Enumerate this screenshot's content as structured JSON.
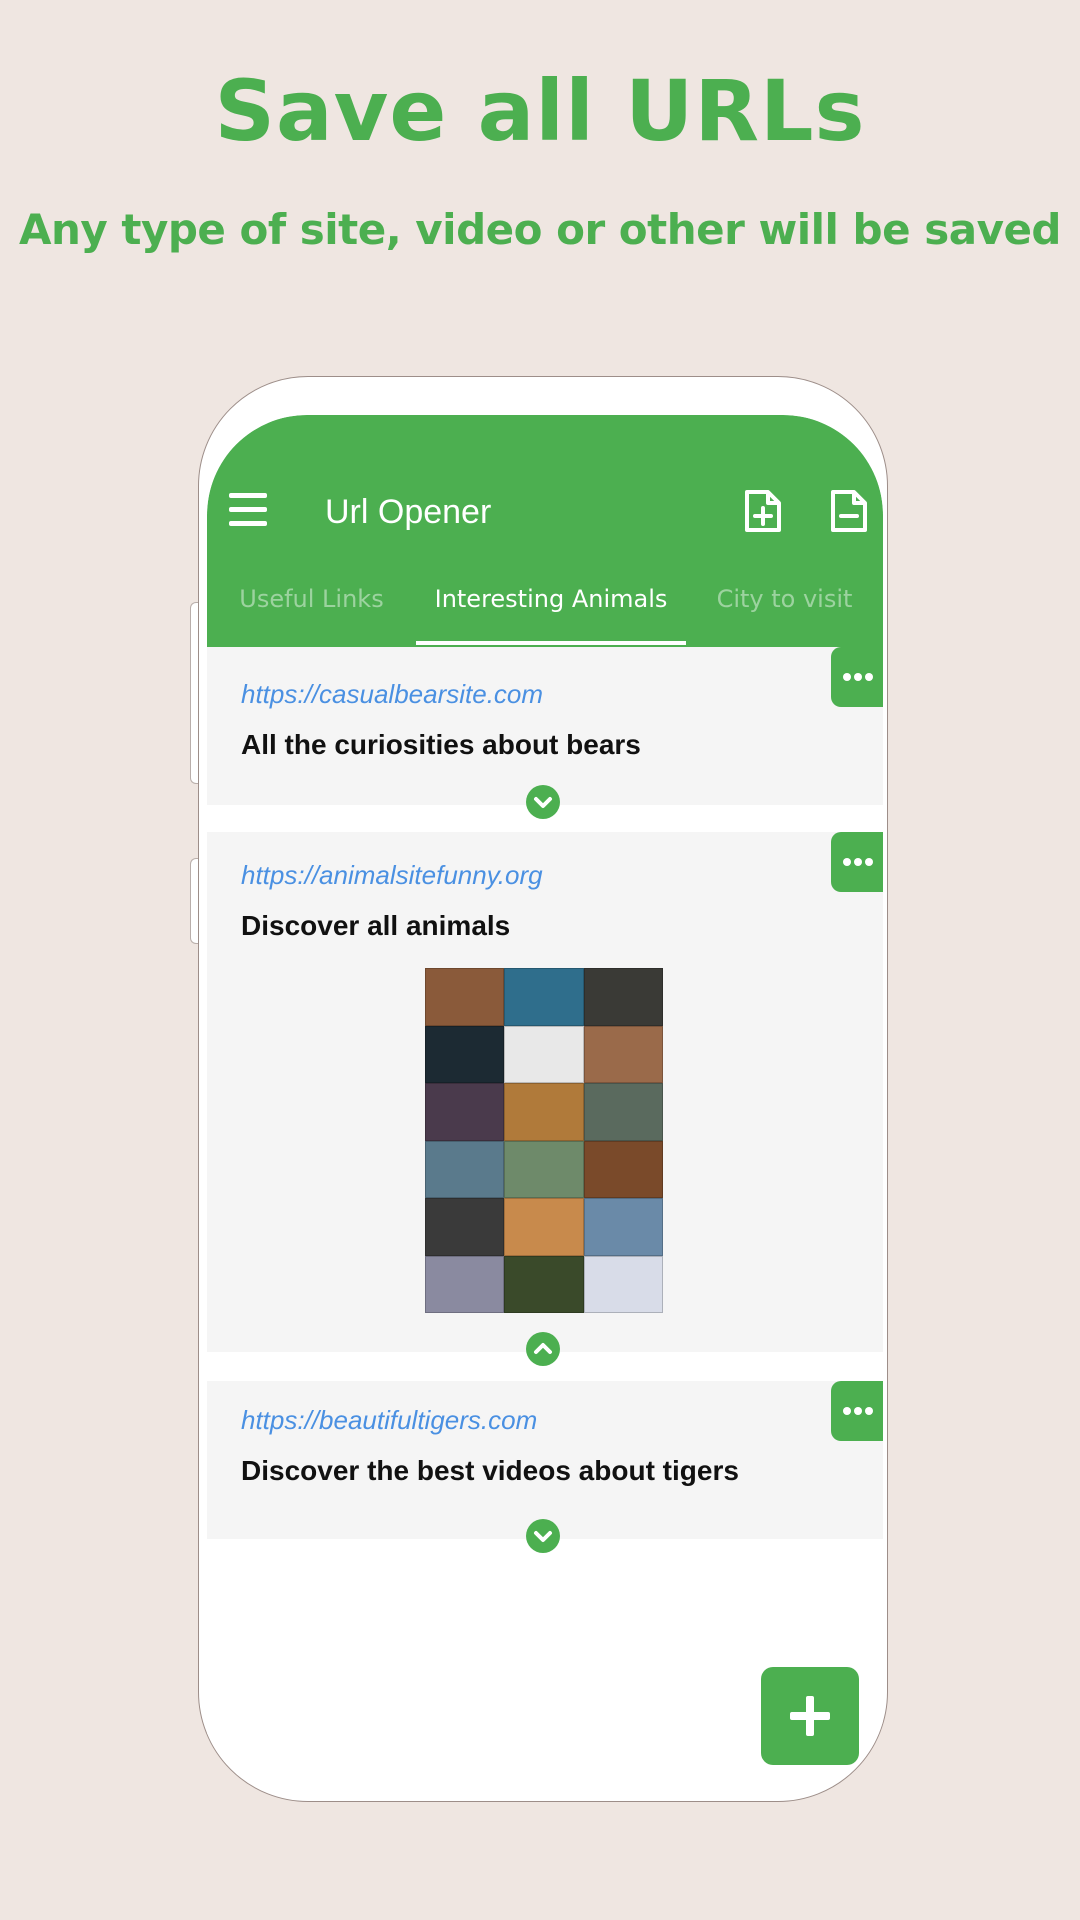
{
  "promo": {
    "title": "Save all URLs",
    "subtitle": "Any type of site, video or other will be saved"
  },
  "app": {
    "title": "Url Opener",
    "icons": [
      "menu-icon",
      "file-add-icon",
      "file-remove-icon"
    ]
  },
  "tabs": [
    {
      "label": "Useful Links",
      "active": false
    },
    {
      "label": "Interesting Animals",
      "active": true
    },
    {
      "label": "City to visit",
      "active": false
    }
  ],
  "cards": [
    {
      "url": "https://casualbearsite.com",
      "title": "All the curiosities about bears",
      "expanded": false
    },
    {
      "url": "https://animalsitefunny.org",
      "title": "Discover all animals",
      "expanded": true
    },
    {
      "url": "https://beautifultigers.com",
      "title": "Discover the best videos about tigers",
      "expanded": false
    }
  ],
  "colors": {
    "accent": "#4caf50",
    "background": "#efe6e1",
    "url": "#4a90e2",
    "card": "#f5f5f5"
  },
  "thumb_colors": [
    "#8a5a3a",
    "#2f6e8c",
    "#3a3a36",
    "#1c2a33",
    "#e8e8e8",
    "#9a6a4a",
    "#4a3a4c",
    "#b07a3a",
    "#5a6a5e",
    "#5a7a8c",
    "#6e8a6a",
    "#7a4a2a",
    "#3a3a3a",
    "#c88a4c",
    "#6a8aa8",
    "#8a8aa0",
    "#3a4a2a",
    "#d8dce8"
  ],
  "fab_icon": "plus-icon"
}
